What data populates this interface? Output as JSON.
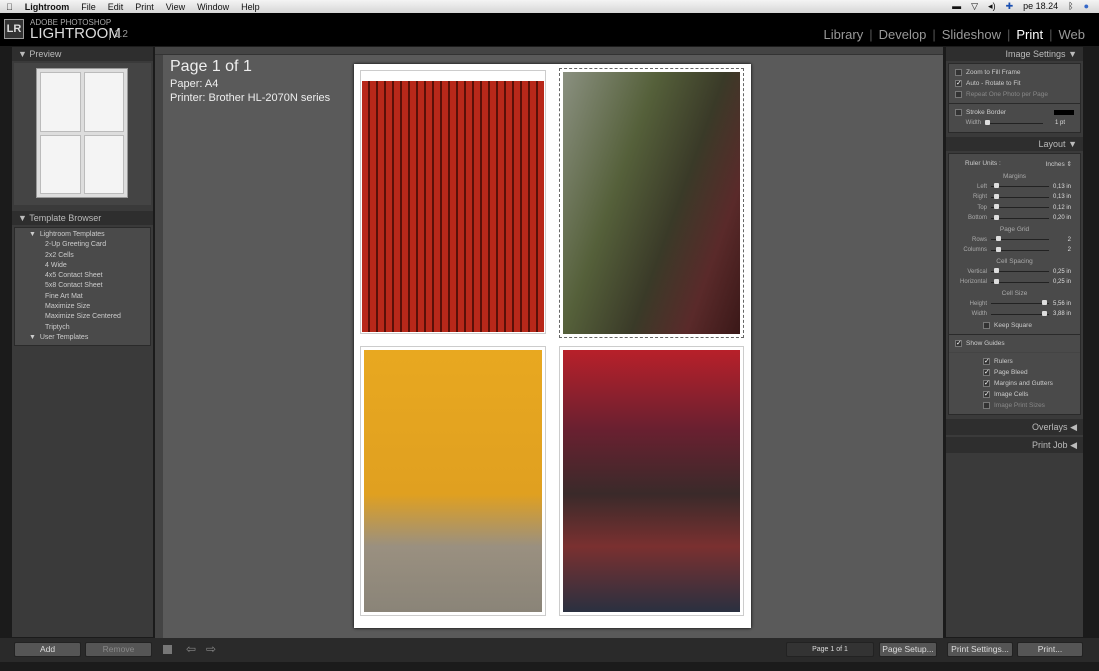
{
  "menubar": {
    "app": "Lightroom",
    "items": [
      "File",
      "Edit",
      "Print",
      "View",
      "Window",
      "Help"
    ],
    "clock": "pe 18.24"
  },
  "header": {
    "brand_top": "ADOBE PHOTOSHOP",
    "brand": "LIGHTROOM",
    "version": "1.2",
    "logo": "LR",
    "modules": [
      "Library",
      "Develop",
      "Slideshow",
      "Print",
      "Web"
    ],
    "active_module": "Print"
  },
  "left": {
    "preview_title": "Preview",
    "template_title": "Template Browser",
    "lightroom_templates": "Lightroom Templates",
    "templates": [
      "2-Up Greeting Card",
      "2x2 Cells",
      "4 Wide",
      "4x5 Contact Sheet",
      "5x8 Contact Sheet",
      "Fine Art Mat",
      "Maximize Size",
      "Maximize Size Centered",
      "Triptych"
    ],
    "user_templates": "User Templates",
    "add": "Add",
    "remove": "Remove"
  },
  "page_info": {
    "page": "Page 1 of 1",
    "paper": "Paper:  A4",
    "printer": "Printer:  Brother HL-2070N series"
  },
  "photos": [
    {
      "desc": "red door",
      "color": "#c8321e"
    },
    {
      "desc": "temple roof",
      "color": "#55603a"
    },
    {
      "desc": "yellow wall",
      "color": "#e8a820"
    },
    {
      "desc": "night market",
      "color": "#8a2a3a"
    }
  ],
  "right": {
    "image_settings": {
      "title": "Image Settings",
      "zoom_fill": "Zoom to Fill Frame",
      "zoom_fill_checked": false,
      "auto_rotate": "Auto - Rotate to Fit",
      "auto_rotate_checked": true,
      "repeat": "Repeat One Photo per Page",
      "repeat_checked": false,
      "stroke": "Stroke Border",
      "stroke_checked": false,
      "width_label": "Width",
      "width_value": "1 pt"
    },
    "layout": {
      "title": "Layout",
      "ruler_units_label": "Ruler Units :",
      "ruler_units": "Inches",
      "margins_title": "Margins",
      "margins": [
        {
          "label": "Left",
          "value": "0,13 in",
          "pos": 0.05
        },
        {
          "label": "Right",
          "value": "0,13 in",
          "pos": 0.05
        },
        {
          "label": "Top",
          "value": "0,12 in",
          "pos": 0.05
        },
        {
          "label": "Bottom",
          "value": "0,20 in",
          "pos": 0.05
        }
      ],
      "grid_title": "Page Grid",
      "grid": [
        {
          "label": "Rows",
          "value": "2",
          "pos": 0.1
        },
        {
          "label": "Columns",
          "value": "2",
          "pos": 0.1
        }
      ],
      "spacing_title": "Cell Spacing",
      "spacing": [
        {
          "label": "Vertical",
          "value": "0,25 in",
          "pos": 0.05
        },
        {
          "label": "Horizontal",
          "value": "0,25 in",
          "pos": 0.05
        }
      ],
      "size_title": "Cell Size",
      "size": [
        {
          "label": "Height",
          "value": "5,56 in",
          "pos": 0.95
        },
        {
          "label": "Width",
          "value": "3,88 in",
          "pos": 0.95
        }
      ],
      "keep_square": "Keep Square"
    },
    "guides": {
      "show": "Show Guides",
      "items": [
        {
          "label": "Rulers",
          "checked": true
        },
        {
          "label": "Page Bleed",
          "checked": true
        },
        {
          "label": "Margins and Gutters",
          "checked": true
        },
        {
          "label": "Image Cells",
          "checked": true
        },
        {
          "label": "Image Print Sizes",
          "checked": false
        }
      ]
    },
    "overlays": "Overlays",
    "print_job": "Print Job"
  },
  "bottom": {
    "page_field": "Page 1 of 1",
    "page_setup": "Page Setup...",
    "print_settings": "Print Settings...",
    "print": "Print..."
  }
}
